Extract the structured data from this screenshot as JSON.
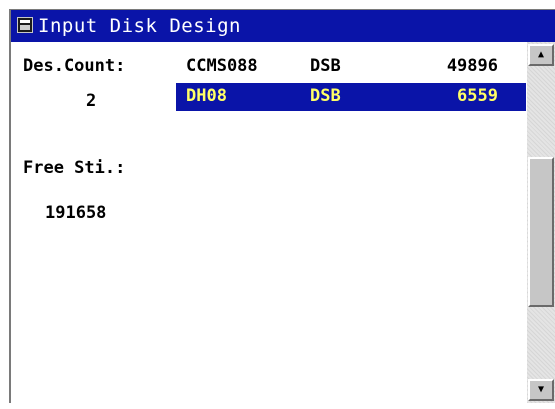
{
  "window": {
    "title": "Input Disk Design"
  },
  "labels": {
    "des_count": "Des.Count:",
    "des_count_value": "2",
    "free_sti": "Free Sti.:",
    "free_sti_value": "191658"
  },
  "designs": [
    {
      "name": "CCMS088",
      "type": "DSB",
      "size": "49896",
      "selected": false
    },
    {
      "name": "DH08",
      "type": "DSB",
      "size": "6559",
      "selected": true
    }
  ],
  "scrollbar": {
    "up_icon": "arrow-up-icon",
    "down_icon": "arrow-down-icon"
  },
  "colors": {
    "titlebar": "#0a14a8",
    "selection_bg": "#0a14a8",
    "selection_text": "#ffff66"
  }
}
